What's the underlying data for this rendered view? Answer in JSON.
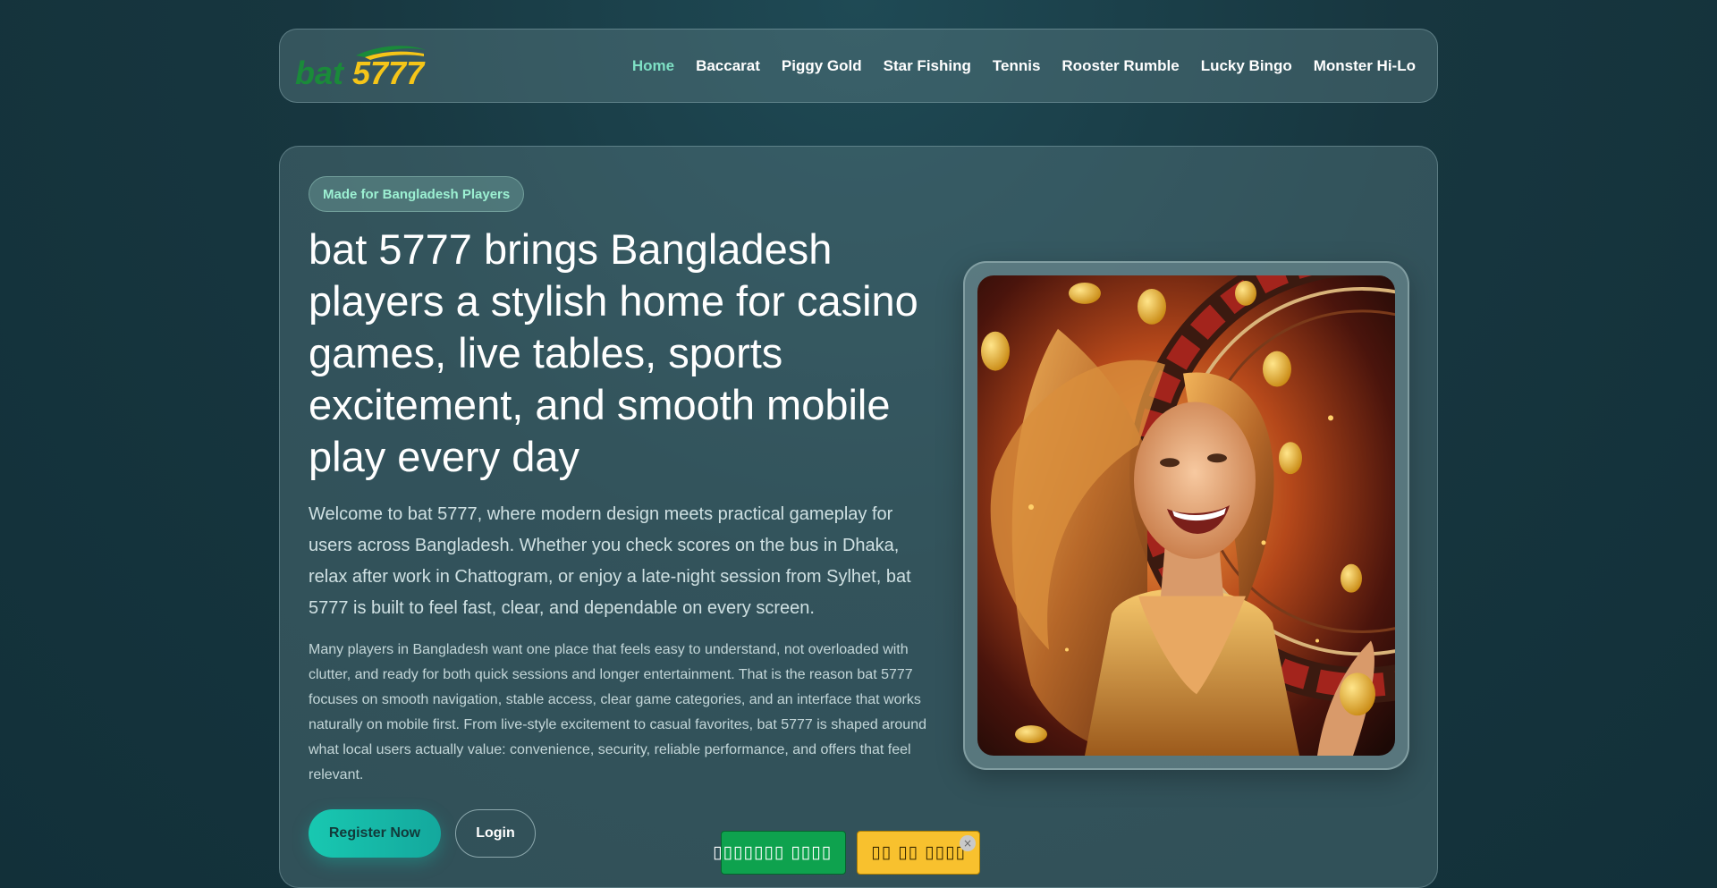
{
  "brand": {
    "logo_text_a": "bat",
    "logo_text_b": "5777"
  },
  "nav": {
    "items": [
      {
        "label": "Home",
        "active": true
      },
      {
        "label": "Baccarat"
      },
      {
        "label": "Piggy Gold"
      },
      {
        "label": "Star Fishing"
      },
      {
        "label": "Tennis"
      },
      {
        "label": "Rooster Rumble"
      },
      {
        "label": "Lucky Bingo"
      },
      {
        "label": "Monster Hi-Lo"
      }
    ]
  },
  "hero": {
    "badge": "Made for Bangladesh Players",
    "headline": "bat 5777 brings Bangladesh players a stylish home for casino games, live tables, sports excitement, and smooth mobile play every day",
    "lead": "Welcome to bat 5777, where modern design meets practical gameplay for users across Bangladesh. Whether you check scores on the bus in Dhaka, relax after work in Chattogram, or enjoy a late-night session from Sylhet, bat 5777 is built to feel fast, clear, and dependable on every screen.",
    "body": "Many players in Bangladesh want one place that feels easy to understand, not overloaded with clutter, and ready for both quick sessions and longer entertainment. That is the reason bat 5777 focuses on smooth navigation, stable access, clear game categories, and an interface that works naturally on mobile first. From live-style excitement to casual favorites, bat 5777 is shaped around what local users actually value: convenience, security, reliable performance, and offers that feel relevant.",
    "register_label": "Register Now",
    "login_label": "Login"
  },
  "floating": {
    "green_label": "▯▯▯▯▯▯▯ ▯▯▯▯",
    "yellow_label": "▯▯ ▯▯ ▯▯▯▯",
    "close_glyph": "×"
  },
  "colors": {
    "accent": "#7ee0c4",
    "register_bg": "#18c8b1",
    "float_green": "#0ea24e",
    "float_yellow": "#f8c12e",
    "logo_green": "#1a8a3a",
    "logo_yellow": "#f5c518"
  }
}
